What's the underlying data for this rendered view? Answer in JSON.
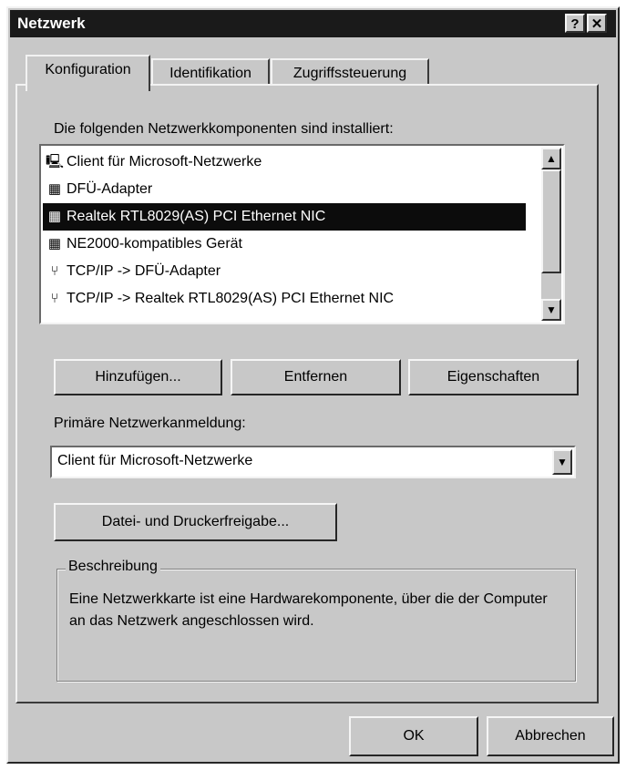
{
  "window": {
    "title": "Netzwerk",
    "help_button": "?",
    "close_button": "✕"
  },
  "tabs": [
    {
      "label": "Konfiguration",
      "active": true
    },
    {
      "label": "Identifikation",
      "active": false
    },
    {
      "label": "Zugriffssteuerung",
      "active": false
    }
  ],
  "components": {
    "heading": "Die folgenden Netzwerkkomponenten sind installiert:",
    "items": [
      {
        "label": "Client für Microsoft-Netzwerke",
        "icon": "computer-icon",
        "selected": false
      },
      {
        "label": "DFÜ-Adapter",
        "icon": "network-card-icon",
        "selected": false
      },
      {
        "label": "Realtek RTL8029(AS) PCI Ethernet NIC",
        "icon": "network-card-icon",
        "selected": true
      },
      {
        "label": "NE2000-kompatibles Gerät",
        "icon": "network-card-icon",
        "selected": false
      },
      {
        "label": "TCP/IP -> DFÜ-Adapter",
        "icon": "protocol-icon",
        "selected": false
      },
      {
        "label": "TCP/IP -> Realtek RTL8029(AS) PCI Ethernet NIC",
        "icon": "protocol-icon",
        "selected": false
      }
    ]
  },
  "buttons": {
    "add": "Hinzufügen...",
    "remove": "Entfernen",
    "properties": "Eigenschaften",
    "sharing": "Datei- und Druckerfreigabe...",
    "ok": "OK",
    "cancel": "Abbrechen"
  },
  "primary_logon": {
    "label": "Primäre Netzwerkanmeldung:",
    "value": "Client für Microsoft-Netzwerke"
  },
  "description": {
    "legend": "Beschreibung",
    "text": "Eine Netzwerkkarte ist eine Hardwarekomponente, über die der Computer an das Netzwerk angeschlossen wird."
  },
  "colors": {
    "selection_bg": "#0c0c0c",
    "titlebar_bg": "#1a1a1a",
    "face": "#c8c8c8"
  }
}
